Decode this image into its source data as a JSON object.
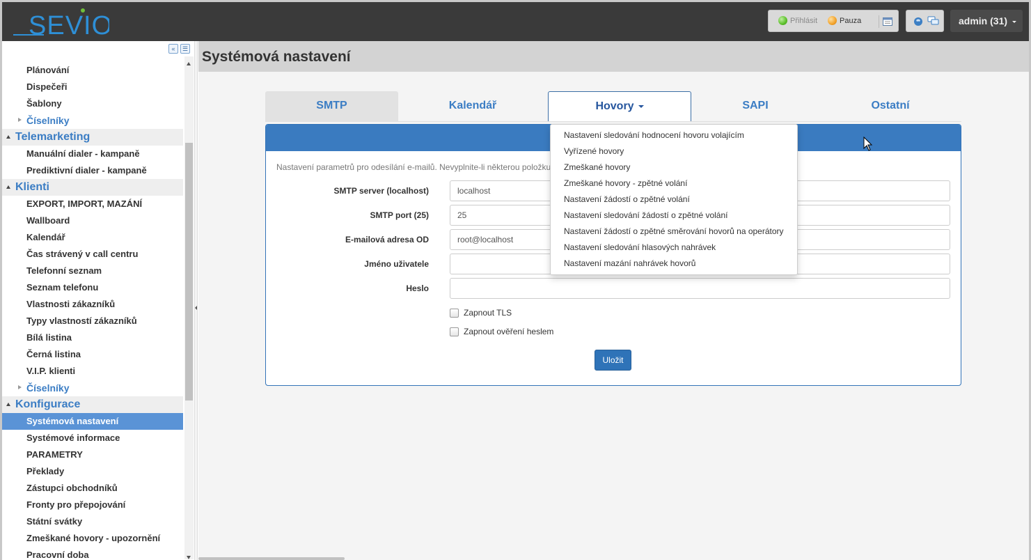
{
  "header": {
    "logo_text": "SEVIO",
    "status": {
      "login_label": "Přihlásit",
      "pause_label": "Pauza"
    },
    "user": {
      "label": "admin (31)"
    }
  },
  "sidebar": {
    "items": [
      {
        "label": "Plánování",
        "type": "item"
      },
      {
        "label": "Dispečeři",
        "type": "item"
      },
      {
        "label": "Šablony",
        "type": "item"
      },
      {
        "label": "Číselníky",
        "type": "sub"
      },
      {
        "label": "Telemarketing",
        "type": "section"
      },
      {
        "label": "Manuální dialer - kampaně",
        "type": "item"
      },
      {
        "label": "Prediktivní dialer - kampaně",
        "type": "item"
      },
      {
        "label": "Klienti",
        "type": "section"
      },
      {
        "label": "EXPORT, IMPORT, MAZÁNÍ",
        "type": "item"
      },
      {
        "label": "Wallboard",
        "type": "item"
      },
      {
        "label": "Kalendář",
        "type": "item"
      },
      {
        "label": "Čas strávený v call centru",
        "type": "item"
      },
      {
        "label": "Telefonní seznam",
        "type": "item"
      },
      {
        "label": "Seznam telefonu",
        "type": "item"
      },
      {
        "label": "Vlastnosti zákazníků",
        "type": "item"
      },
      {
        "label": "Typy vlastností zákazníků",
        "type": "item"
      },
      {
        "label": "Bílá listina",
        "type": "item"
      },
      {
        "label": "Černá listina",
        "type": "item"
      },
      {
        "label": "V.I.P. klienti",
        "type": "item"
      },
      {
        "label": "Číselníky",
        "type": "sub"
      },
      {
        "label": "Konfigurace",
        "type": "section"
      },
      {
        "label": "Systémová nastavení",
        "type": "active"
      },
      {
        "label": "Systémové informace",
        "type": "item"
      },
      {
        "label": "PARAMETRY",
        "type": "item"
      },
      {
        "label": "Překlady",
        "type": "item"
      },
      {
        "label": "Zástupci obchodníků",
        "type": "item"
      },
      {
        "label": "Fronty pro přepojování",
        "type": "item"
      },
      {
        "label": "Státní svátky",
        "type": "item"
      },
      {
        "label": "Zmeškané hovory - upozornění",
        "type": "item"
      },
      {
        "label": "Pracovní doba",
        "type": "item"
      }
    ]
  },
  "main": {
    "title": "Systémová nastavení",
    "tabs": [
      {
        "label": "SMTP"
      },
      {
        "label": "Kalendář"
      },
      {
        "label": "Hovory"
      },
      {
        "label": "SAPI"
      },
      {
        "label": "Ostatní"
      }
    ],
    "hovory_menu": [
      "Nastavení sledování hodnocení hovoru volajícím",
      "Vyřízené hovory",
      "Zmeškané hovory",
      "Zmeškané hovory - zpětné volání",
      "Nastavení žádostí o zpětné volání",
      "Nastavení sledování žádostí o zpětné volání",
      "Nastavení žádostí o zpětné směrování hovorů na operátory",
      "Nastavení sledování hlasových nahrávek",
      "Nastavení mazání nahrávek hovorů"
    ],
    "form": {
      "description": "Nastavení parametrů pro odesílání e-mailů. Nevyplnite-li některou položku",
      "fields": [
        {
          "label": "SMTP server (localhost)",
          "value": "localhost"
        },
        {
          "label": "SMTP port (25)",
          "value": "25"
        },
        {
          "label": "E-mailová adresa OD",
          "value": "root@localhost"
        },
        {
          "label": "Jméno uživatele",
          "value": ""
        },
        {
          "label": "Heslo",
          "value": ""
        }
      ],
      "checkboxes": [
        {
          "label": "Zapnout TLS",
          "checked": false
        },
        {
          "label": "Zapnout ověření heslem",
          "checked": false
        }
      ],
      "save_label": "Uložit"
    }
  }
}
